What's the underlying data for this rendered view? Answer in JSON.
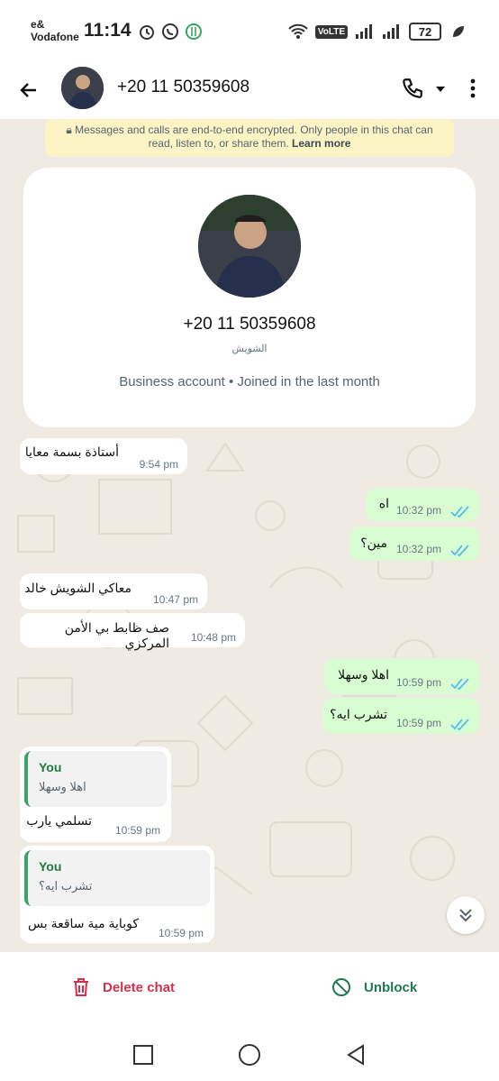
{
  "status_bar": {
    "carrier": "e& Vodafone",
    "time": "11:14",
    "network_badge": "VoLTE",
    "battery": "72"
  },
  "header": {
    "title": "+20 11 50359608"
  },
  "encryption_notice": {
    "text": "Messages and calls are end-to-end encrypted. Only people in this chat can read, listen to, or share them.",
    "link": "Learn more"
  },
  "profile_card": {
    "phone": "+20 11 50359608",
    "name": "الشويش",
    "meta": "Business account • Joined in the last month"
  },
  "messages": [
    {
      "dir": "in",
      "text": "أستاذة بسمة معايا",
      "time": "9:54 pm"
    },
    {
      "dir": "out",
      "text": "اه",
      "time": "10:32 pm"
    },
    {
      "dir": "out",
      "text": "مين؟",
      "time": "10:32 pm"
    },
    {
      "dir": "in",
      "text": "معاكي الشويش خالد",
      "time": "10:47 pm"
    },
    {
      "dir": "in",
      "text": "صف ظابط بي الأمن المركزي",
      "time": "10:48 pm"
    },
    {
      "dir": "out",
      "text": "اهلا وسهلا",
      "time": "10:59 pm"
    },
    {
      "dir": "out",
      "text": "تشرب ايه؟",
      "time": "10:59 pm"
    },
    {
      "dir": "in",
      "quote_author": "You",
      "quote_text": "اهلا وسهلا",
      "text": "تسلمي يارب",
      "time": "10:59 pm"
    },
    {
      "dir": "in",
      "quote_author": "You",
      "quote_text": "تشرب ايه؟",
      "text": "كوباية مية ساقعة بس",
      "time": "10:59 pm"
    }
  ],
  "actions": {
    "delete_label": "Delete chat",
    "unblock_label": "Unblock"
  },
  "colors": {
    "chat_bg": "#efeae2",
    "outgoing_bubble": "#d9fdd3",
    "read_ticks": "#53bdeb",
    "delete": "#d1304b",
    "unblock": "#1f7a4f"
  }
}
